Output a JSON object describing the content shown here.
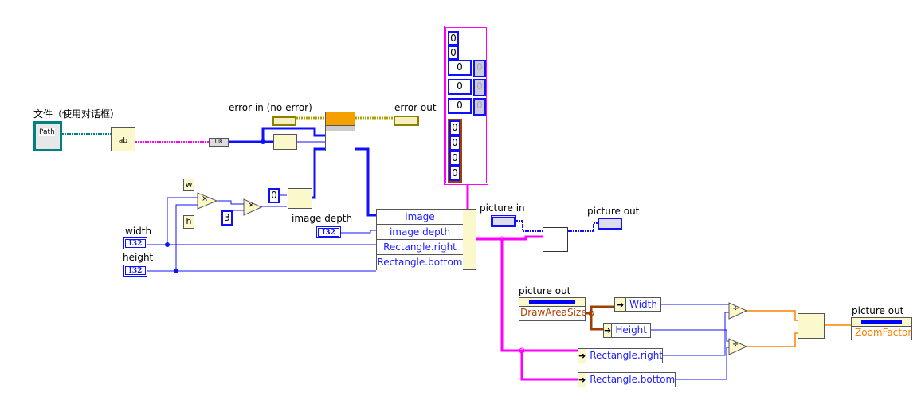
{
  "labels": {
    "file_dialog": "文件（使用对话框）",
    "path_control": "Path",
    "error_in": "error in (no error)",
    "error_out": "error out",
    "width": "width",
    "height": "height",
    "image_depth": "image depth",
    "picture_in": "picture in",
    "picture_out_1": "picture out",
    "picture_out_2": "picture out",
    "picture_out_3": "picture out",
    "typecast": "U8",
    "w": "w",
    "h": "h",
    "i32": "I32"
  },
  "constants": {
    "zero": "0",
    "three": "3"
  },
  "bundle": {
    "rows": [
      "image",
      "image depth",
      "Rectangle.right",
      "Rectangle.bottom"
    ]
  },
  "cluster_constant": {
    "values": [
      "0",
      "0",
      "0",
      "0",
      "0",
      "0",
      "0",
      "0",
      "0"
    ],
    "dim_values": [
      "0",
      "0",
      "0"
    ]
  },
  "property_node_1": {
    "property": "DrawAreaSize"
  },
  "unbundle": {
    "width": "Width",
    "height": "Height",
    "rect_right": "Rectangle.right",
    "rect_bottom": "Rectangle.bottom"
  },
  "property_node_2": {
    "property": "ZoomFactor"
  },
  "operators": {
    "multiply": "×",
    "divide": "÷"
  },
  "colors": {
    "int_wire": "#1010ff",
    "cluster_wire": "#ff00ff",
    "error_wire": "#b0a000",
    "float_wire": "#ff8000",
    "refnum_wire": "#a04000"
  }
}
